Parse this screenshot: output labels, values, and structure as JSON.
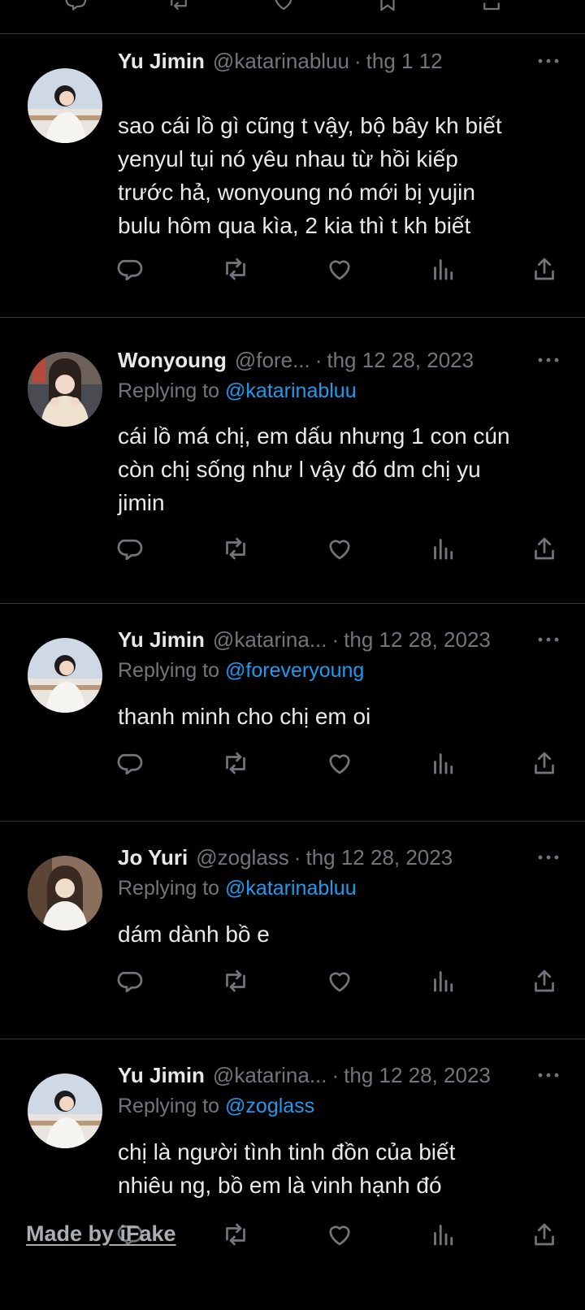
{
  "icons": {
    "reply": "reply-icon",
    "retweet": "retweet-icon",
    "like": "like-icon",
    "views": "views-icon",
    "share": "share-icon",
    "more": "more-icon",
    "bookmark": "bookmark-icon"
  },
  "colors": {
    "background": "#000000",
    "text": "#e7e9ea",
    "muted": "#71767b",
    "link": "#1d9bf0",
    "divider": "#2f3336"
  },
  "tweets": [
    {
      "name": "Yu Jimin",
      "handle": "@katarinabluu",
      "separator": "·",
      "date": "thg 1 12",
      "replying_prefix": "",
      "replying_to": "",
      "body_lines": [
        "sao cái lồ gì cũng t vậy, bộ bây kh biết",
        "yenyul tụi nó yêu nhau từ hồi kiếp",
        "trước hả, wonyoung nó mới bị yujin",
        "bulu hôm qua kìa, 2 kia thì t kh biết"
      ]
    },
    {
      "name": "Wonyoung",
      "handle": "@fore...",
      "separator": "·",
      "date": "thg 12 28, 2023",
      "replying_prefix": "Replying to",
      "replying_to": "@katarinabluu",
      "body_lines": [
        "cái lồ má chị, em dấu nhưng 1 con cún",
        "còn chị sống như l vậy đó dm chị yu",
        "jimin"
      ]
    },
    {
      "name": "Yu Jimin",
      "handle": "@katarina...",
      "separator": "·",
      "date": "thg 12 28, 2023",
      "replying_prefix": "Replying to",
      "replying_to": "@foreveryoung",
      "body_lines": [
        "thanh minh cho chị em oi"
      ]
    },
    {
      "name": "Jo Yuri",
      "handle": "@zoglass",
      "separator": "·",
      "date": "thg 12 28, 2023",
      "replying_prefix": "Replying to",
      "replying_to": "@katarinabluu",
      "body_lines": [
        "dám dành bồ e"
      ]
    },
    {
      "name": "Yu Jimin",
      "handle": "@katarina...",
      "separator": "·",
      "date": "thg 12 28, 2023",
      "replying_prefix": "Replying to",
      "replying_to": "@zoglass",
      "body_lines": [
        "chị là người tình tinh đồn của biết",
        "nhiêu ng, bồ em là vinh hạnh đó"
      ]
    }
  ],
  "watermark": "Made by iFake"
}
